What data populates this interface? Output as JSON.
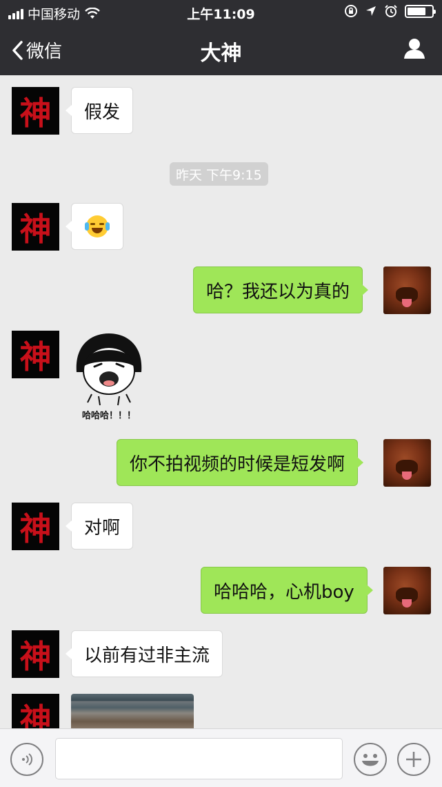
{
  "status_bar": {
    "carrier": "中国移动",
    "time": "上午11:09"
  },
  "nav": {
    "back_label": "微信",
    "title": "大神"
  },
  "contact_avatar_char": "神",
  "timestamp": "昨天 下午9:15",
  "messages": [
    {
      "side": "in",
      "text": "假发"
    },
    {
      "side": "in",
      "emoji": "crying-laughing-emoji"
    },
    {
      "side": "out",
      "text": "哈？我还以为真的"
    },
    {
      "side": "in",
      "sticker_caption": "哈哈哈！！！"
    },
    {
      "side": "out",
      "text": "你不拍视频的时候是短发啊"
    },
    {
      "side": "in",
      "text": "对啊"
    },
    {
      "side": "out",
      "text": "哈哈哈，心机boy"
    },
    {
      "side": "in",
      "text": "以前有过非主流"
    },
    {
      "side": "in",
      "image": "photo-thumbnail"
    }
  ],
  "icons": [
    "wifi-icon",
    "lock-rotation-icon",
    "location-icon",
    "alarm-icon",
    "battery-icon",
    "back-chevron-icon",
    "profile-icon",
    "voice-icon",
    "emoji-icon",
    "plus-icon"
  ],
  "colors": {
    "header_bg": "#2e2e32",
    "chat_bg": "#ebebeb",
    "outgoing_bubble": "#9fe658",
    "incoming_bubble": "#ffffff"
  }
}
